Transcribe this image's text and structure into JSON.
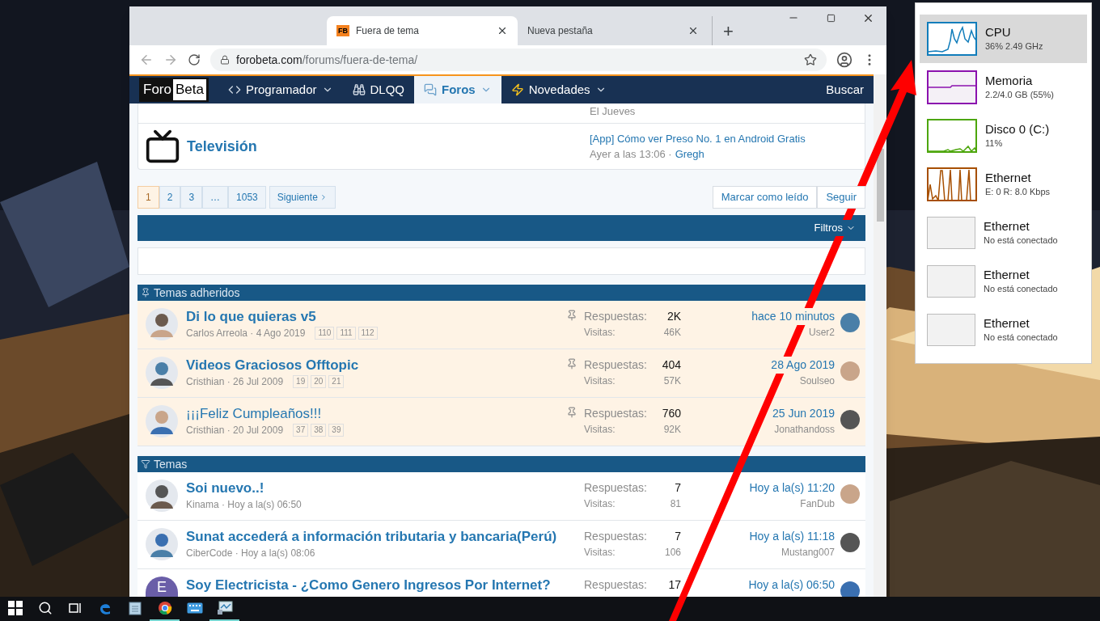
{
  "browser": {
    "tabs": [
      {
        "title": "Fuera de tema",
        "favicon": "FB",
        "selected": true
      },
      {
        "title": "Nueva pestaña",
        "selected": false
      }
    ],
    "new_tab": "+",
    "address_host": "forobeta.com",
    "address_path": "/forums/fuera-de-tema/"
  },
  "site": {
    "logo": [
      "Foro",
      "Beta"
    ],
    "nav": [
      {
        "label": "Programador",
        "dropdown": true,
        "selected": false
      },
      {
        "label": "DLQQ",
        "dropdown": false,
        "selected": false
      },
      {
        "label": "Foros",
        "dropdown": true,
        "selected": true
      },
      {
        "label": "Novedades",
        "dropdown": true,
        "selected": false
      }
    ],
    "search": "Buscar"
  },
  "forums": {
    "cut_row_meta": "El Jueves",
    "rows": [
      {
        "title": "Televisión",
        "latest": "[App] Cómo ver Preso No. 1 en Android Gratis",
        "time": "Ayer a las 13:06 ·",
        "author": "Gregh"
      }
    ]
  },
  "pagination": {
    "pages": [
      {
        "label": "1",
        "selected": true
      },
      {
        "label": "2",
        "selected": false
      },
      {
        "label": "3",
        "selected": false
      },
      {
        "label": "…",
        "selected": false
      },
      {
        "label": "1053",
        "selected": false
      }
    ],
    "next": "Siguiente",
    "actions": [
      "Marcar como leído",
      "Seguir"
    ]
  },
  "filters": "Filtros",
  "sections": [
    {
      "title": "Temas adheridos",
      "sticky": true,
      "threads": [
        {
          "title": "Di lo que quieras v5",
          "unread": true,
          "meta": "Carlos Arreola · 4 Ago 2019",
          "pages": [
            "110",
            "111",
            "112"
          ],
          "replies_label": "Respuestas:",
          "replies": "2K",
          "views_label": "Visitas:",
          "views": "46K",
          "last_time": "hace 10 minutos",
          "last_user": "User2"
        },
        {
          "title": "Videos Graciosos Offtopic",
          "unread": true,
          "meta": "Cristhian · 26 Jul 2009",
          "pages": [
            "19",
            "20",
            "21"
          ],
          "replies_label": "Respuestas:",
          "replies": "404",
          "views_label": "Visitas:",
          "views": "57K",
          "last_time": "28 Ago 2019",
          "last_user": "Soulseo"
        },
        {
          "title": "¡¡¡Feliz Cumpleaños!!!",
          "unread": false,
          "meta": "Cristhian · 20 Jul 2009",
          "pages": [
            "37",
            "38",
            "39"
          ],
          "replies_label": "Respuestas:",
          "replies": "760",
          "views_label": "Visitas:",
          "views": "92K",
          "last_time": "25 Jun 2019",
          "last_user": "Jonathandoss"
        }
      ]
    },
    {
      "title": "Temas",
      "sticky": false,
      "threads": [
        {
          "title": "Soi nuevo..!",
          "unread": true,
          "meta": "Kinama · Hoy a la(s) 06:50",
          "replies_label": "Respuestas:",
          "replies": "7",
          "views_label": "Visitas:",
          "views": "81",
          "last_time": "Hoy a la(s) 11:20",
          "last_user": "FanDub"
        },
        {
          "title": "Sunat accederá a información tributaria y bancaria(Perú)",
          "unread": true,
          "meta": "CiberCode · Hoy a la(s) 08:06",
          "replies_label": "Respuestas:",
          "replies": "7",
          "views_label": "Visitas:",
          "views": "106",
          "last_time": "Hoy a la(s) 11:18",
          "last_user": "Mustang007"
        },
        {
          "title": "Soy Electricista - ¿Como Genero Ingresos Por Internet?",
          "unread": true,
          "avatar_letter": "E",
          "replies_label": "Respuestas:",
          "replies": "17",
          "last_time": "Hoy a la(s) 06:50"
        }
      ]
    }
  ],
  "task_manager": [
    {
      "name": "CPU",
      "detail": "36% 2.49 GHz",
      "kind": "cpu",
      "color": "#117dbb",
      "selected": true
    },
    {
      "name": "Memoria",
      "detail": "2.2/4.0 GB (55%)",
      "kind": "memory",
      "color": "#8b12ae",
      "selected": false
    },
    {
      "name": "Disco 0 (C:)",
      "detail": "11%",
      "kind": "disk",
      "color": "#4da60c",
      "selected": false
    },
    {
      "name": "Ethernet",
      "detail": "E: 0 R: 8.0 Kbps",
      "kind": "net",
      "color": "#a74f01",
      "selected": false
    },
    {
      "name": "Ethernet",
      "detail": "No está conectado",
      "kind": "off",
      "selected": false
    },
    {
      "name": "Ethernet",
      "detail": "No está conectado",
      "kind": "off",
      "selected": false
    },
    {
      "name": "Ethernet",
      "detail": "No está conectado",
      "kind": "off",
      "selected": false
    }
  ],
  "taskbar": [
    {
      "kind": "start",
      "running": false
    },
    {
      "kind": "search",
      "running": false
    },
    {
      "kind": "taskview",
      "running": false
    },
    {
      "kind": "edge",
      "running": false
    },
    {
      "kind": "notepad",
      "running": false
    },
    {
      "kind": "chrome",
      "running": true
    },
    {
      "kind": "keyboard",
      "running": false
    },
    {
      "kind": "taskmgr",
      "running": true
    }
  ]
}
